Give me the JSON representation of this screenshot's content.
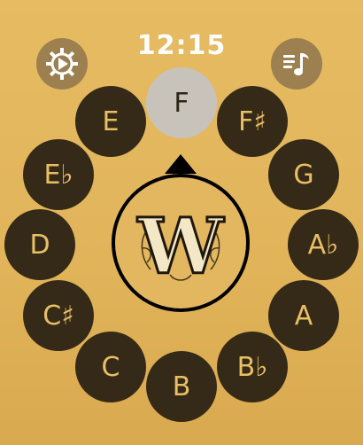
{
  "status_bar": {
    "time": "12:15"
  },
  "buttons": {
    "settings_icon": "gear-play-icon",
    "music_icon": "music-list-icon"
  },
  "notes": {
    "F": "F",
    "Fsharp": "F♯",
    "G": "G",
    "Aflat": "A♭",
    "A": "A",
    "Bflat": "B♭",
    "B": "B",
    "C": "C",
    "Csharp": "C♯",
    "D": "D",
    "Eflat": "E♭",
    "E": "E"
  },
  "selected_note": "F",
  "logo": {
    "letter": "W"
  },
  "colors": {
    "background": "#e3b75f",
    "note_fill": "#352a17",
    "note_text": "#e9bf66",
    "selected_fill": "#c7c3bb"
  }
}
